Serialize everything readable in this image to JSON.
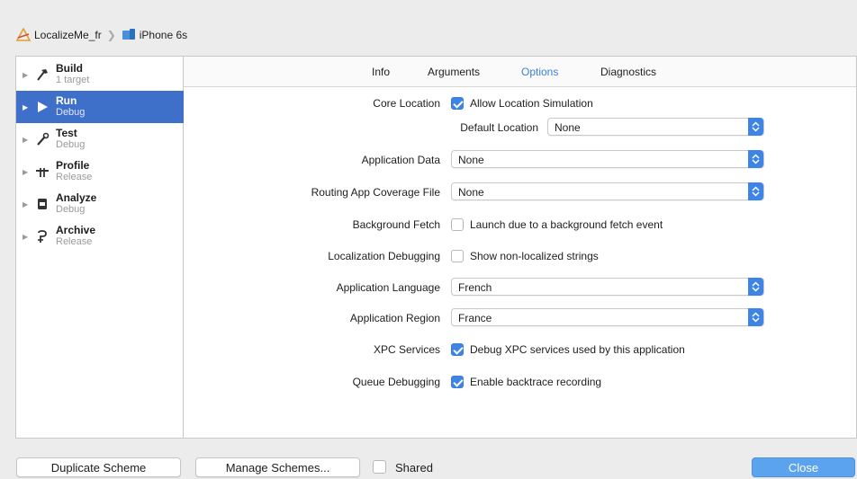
{
  "breadcrumb": {
    "project": "LocalizeMe_fr",
    "device": "iPhone 6s"
  },
  "sidebar": {
    "items": [
      {
        "name": "Build",
        "sub": "1 target",
        "icon": "hammer-icon"
      },
      {
        "name": "Run",
        "sub": "Debug",
        "icon": "play-icon"
      },
      {
        "name": "Test",
        "sub": "Debug",
        "icon": "wrench-icon"
      },
      {
        "name": "Profile",
        "sub": "Release",
        "icon": "instruments-icon"
      },
      {
        "name": "Analyze",
        "sub": "Debug",
        "icon": "analyze-icon"
      },
      {
        "name": "Archive",
        "sub": "Release",
        "icon": "archive-icon"
      }
    ],
    "selected": "Run"
  },
  "tabs": [
    {
      "label": "Info"
    },
    {
      "label": "Arguments"
    },
    {
      "label": "Options"
    },
    {
      "label": "Diagnostics"
    }
  ],
  "active_tab": "Options",
  "options": {
    "core_location": {
      "label": "Core Location",
      "checkbox_text": "Allow Location Simulation",
      "checked": true
    },
    "default_location": {
      "label": "Default Location",
      "value": "None"
    },
    "application_data": {
      "label": "Application Data",
      "value": "None"
    },
    "routing": {
      "label": "Routing App Coverage File",
      "value": "None"
    },
    "background_fetch": {
      "label": "Background Fetch",
      "checkbox_text": "Launch due to a background fetch event",
      "checked": false
    },
    "localization_debugging": {
      "label": "Localization Debugging",
      "checkbox_text": "Show non-localized strings",
      "checked": false
    },
    "application_language": {
      "label": "Application Language",
      "value": "French"
    },
    "application_region": {
      "label": "Application Region",
      "value": "France"
    },
    "xpc_services": {
      "label": "XPC Services",
      "checkbox_text": "Debug XPC services used by this application",
      "checked": true
    },
    "queue_debugging": {
      "label": "Queue Debugging",
      "checkbox_text": "Enable backtrace recording",
      "checked": true
    }
  },
  "footer": {
    "duplicate_label": "Duplicate Scheme",
    "manage_label": "Manage Schemes...",
    "shared_label": "Shared",
    "shared_checked": false,
    "close_label": "Close"
  },
  "colors": {
    "accent": "#3d84e6",
    "selection": "#3f70c9",
    "close_button": "#5ca3ee"
  }
}
